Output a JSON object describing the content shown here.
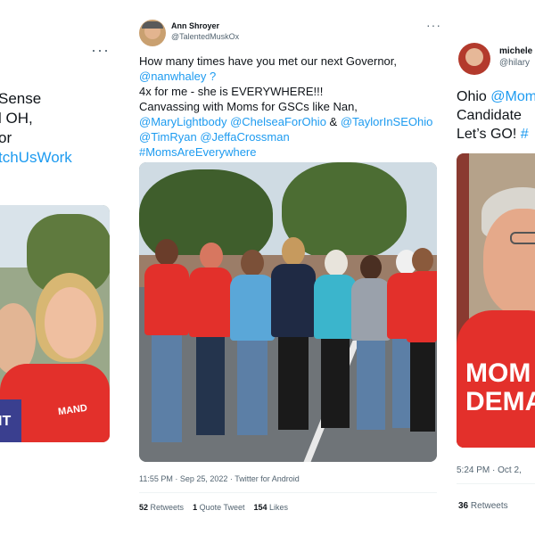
{
  "left": {
    "menu": "···",
    "text_lines": [
      "Sense",
      "l OH,",
      "or",
      "tchUsWork"
    ]
  },
  "middle": {
    "name": "Ann Shroyer",
    "handle": "@TalentedMuskOx",
    "menu": "···",
    "line1": "How many times have you met our next Governor,",
    "line2": "@nanwhaley ?",
    "line3": "4x for me - she is EVERYWHERE!!!",
    "line4": "Canvassing with Moms for GSCs like Nan,",
    "line5_a": "@MaryLightbody @ChelseaForOhio",
    "line5_b": " & ",
    "line5_c": "@TaylorInSEOhio",
    "line6": "@TimRyan @JeffaCrossman",
    "line7": "#MomsAreEverywhere",
    "timestamp": "11:55 PM · Sep 25, 2022 · Twitter for Android",
    "retweets_count": "52",
    "retweets_label": "Retweets",
    "quotes_count": "1",
    "quotes_label": "Quote Tweet",
    "likes_count": "154",
    "likes_label": "Likes"
  },
  "right": {
    "name": "michele",
    "handle": "@hilary",
    "line1_a": "Ohio ",
    "line1_b": "@Mom",
    "line2": "Candidate",
    "line3_a": "Let’s GO! ",
    "line3_b": "#",
    "timestamp": "5:24 PM · Oct 2,",
    "retweets_count": "36",
    "retweets_label": "Retweets",
    "shirt_text_1": "MOM",
    "shirt_text_2": "DEMA"
  },
  "photo_left": {
    "sign_text": "IT",
    "shirt_text": "MAND"
  },
  "colors": {
    "link": "#1d9bf0",
    "muted": "#536471",
    "shirt_red": "#e3302b"
  }
}
